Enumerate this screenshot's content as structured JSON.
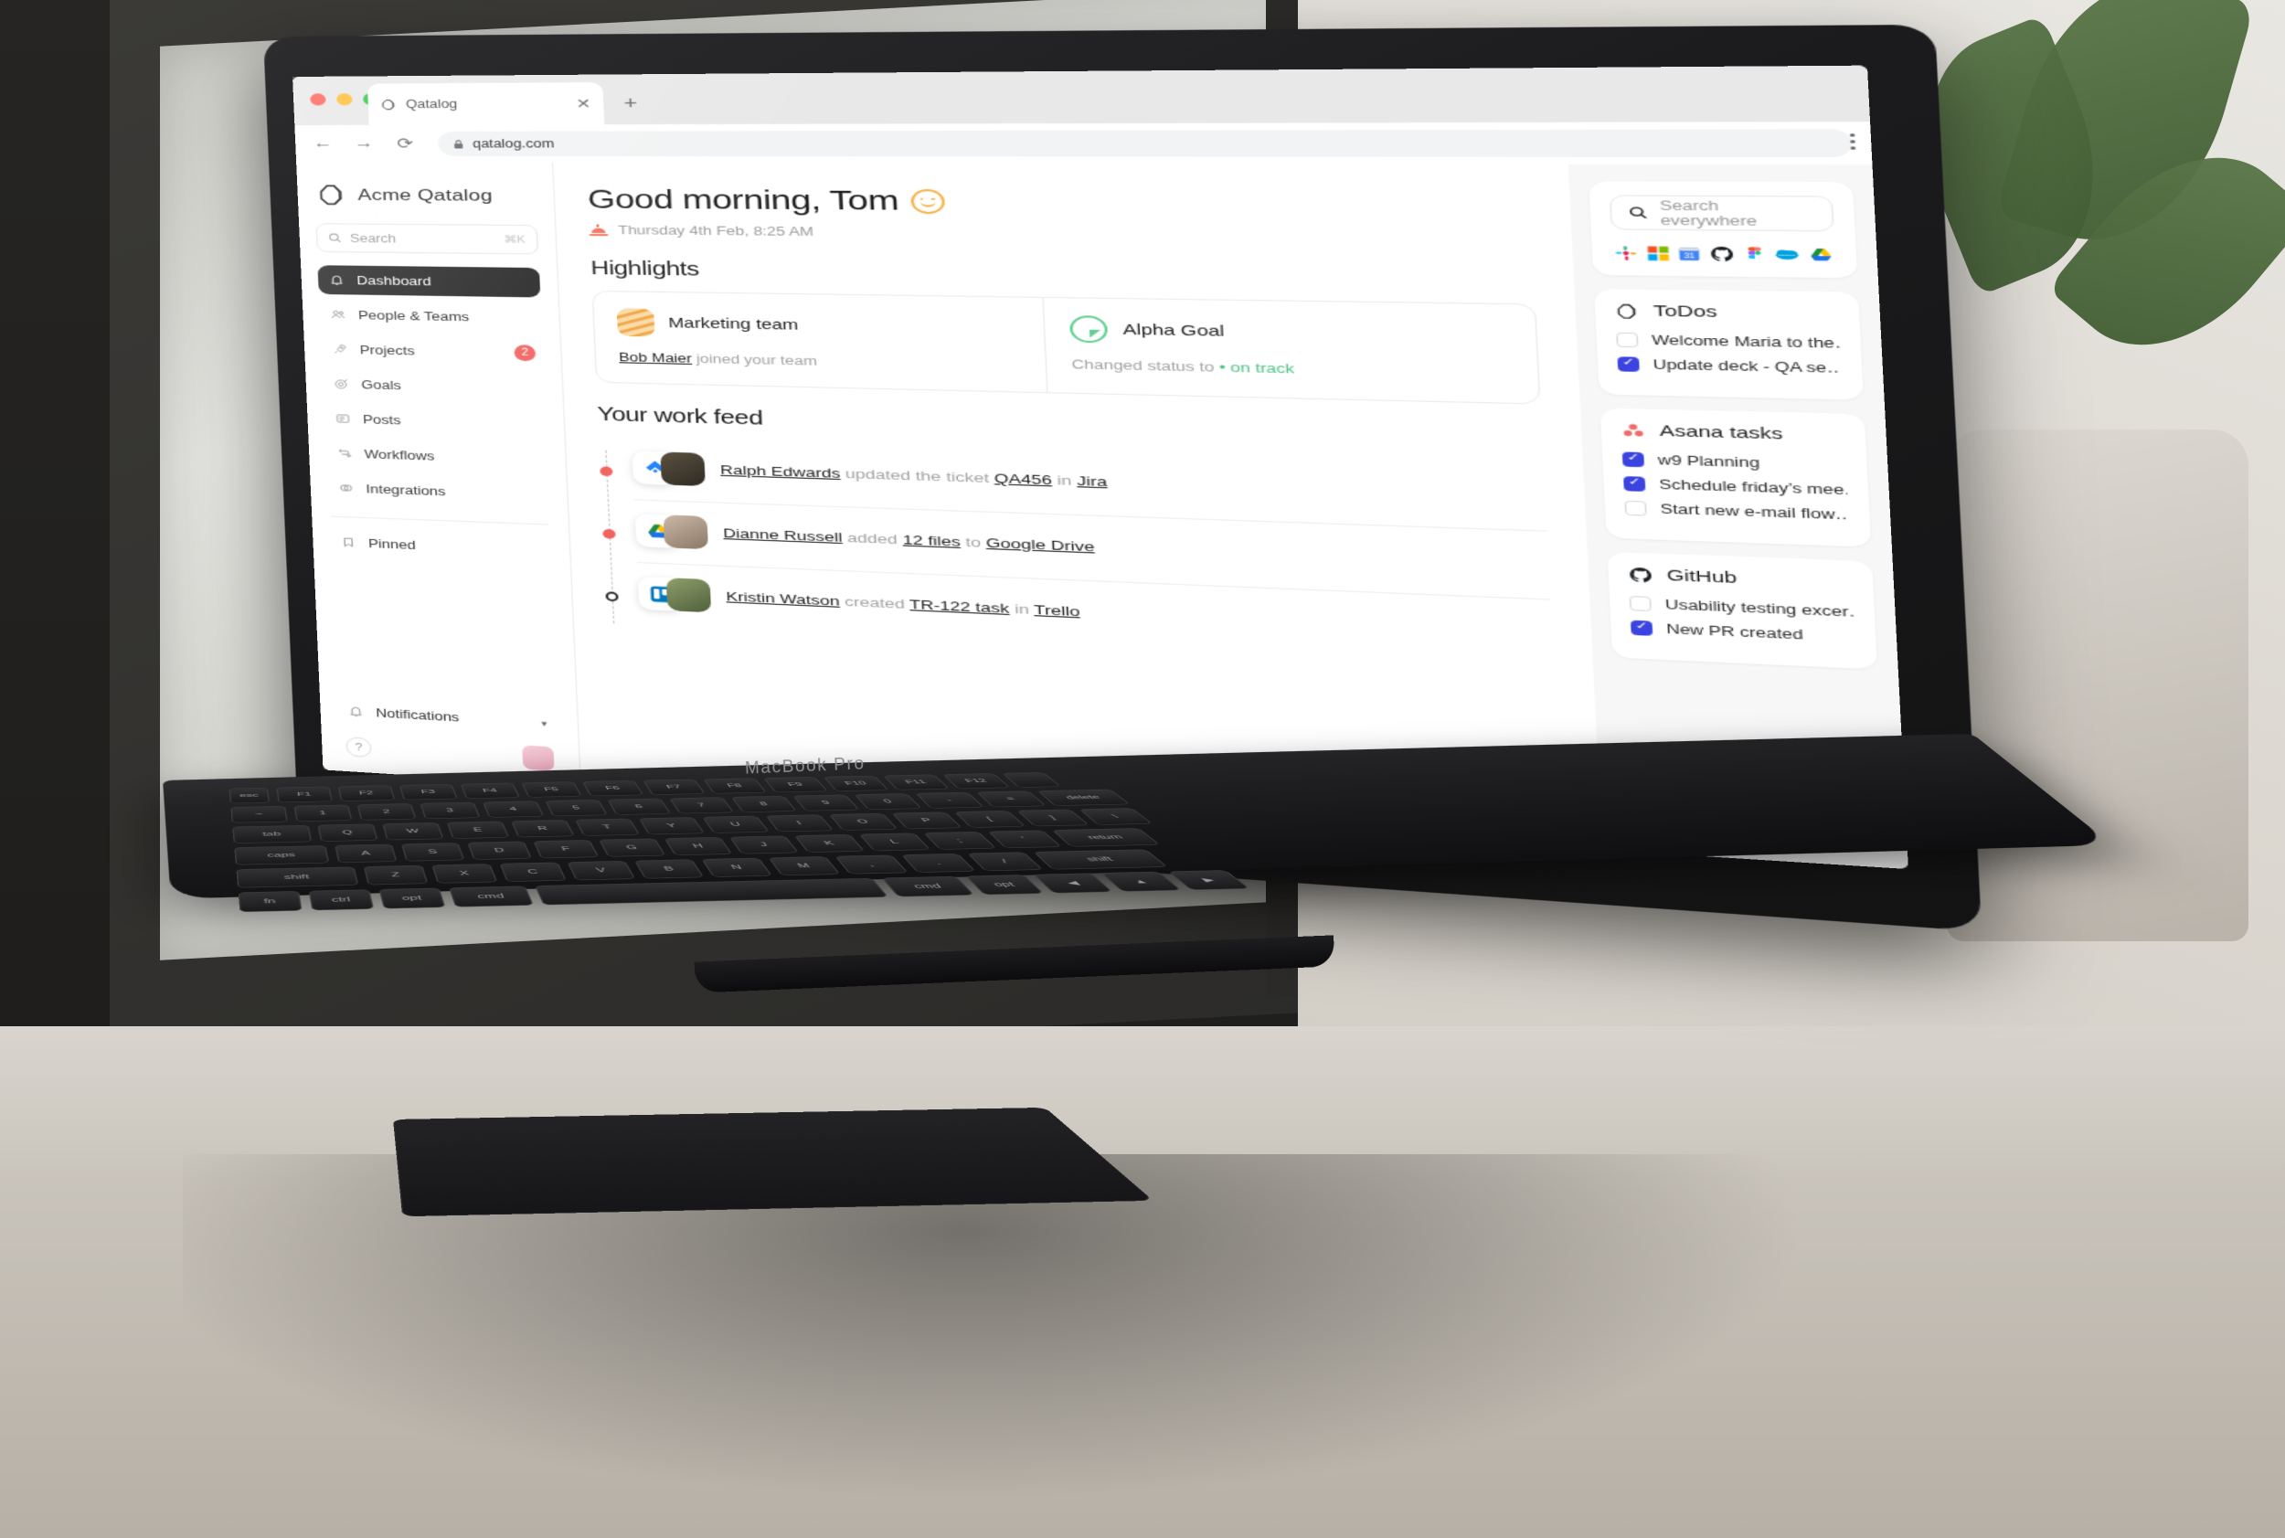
{
  "browser": {
    "tab_title": "Qatalog",
    "tab_close": "✕",
    "new_tab": "+",
    "back": "←",
    "forward": "→",
    "reload": "⟳",
    "url": "qatalog.com",
    "lock_icon": "lock-icon",
    "menu_icon": "kebab-menu-icon"
  },
  "laptop": {
    "model_label": "MacBook Pro"
  },
  "sidebar": {
    "brand": "Acme Qatalog",
    "search": {
      "placeholder": "Search",
      "shortcut": "⌘K"
    },
    "items": [
      {
        "label": "Dashboard",
        "icon": "bell-icon",
        "active": true,
        "badge": ""
      },
      {
        "label": "People & Teams",
        "icon": "people-icon",
        "active": false,
        "badge": ""
      },
      {
        "label": "Projects",
        "icon": "rocket-icon",
        "active": false,
        "badge": "2"
      },
      {
        "label": "Goals",
        "icon": "target-icon",
        "active": false,
        "badge": ""
      },
      {
        "label": "Posts",
        "icon": "posts-icon",
        "active": false,
        "badge": ""
      },
      {
        "label": "Workflows",
        "icon": "workflow-icon",
        "active": false,
        "badge": ""
      },
      {
        "label": "Integrations",
        "icon": "integrations-icon",
        "active": false,
        "badge": ""
      }
    ],
    "pinned": {
      "label": "Pinned",
      "icon": "bookmark-icon"
    },
    "notifications": {
      "label": "Notifications",
      "icon": "bell-icon",
      "chevron": "▾"
    },
    "help_icon": "help-circle-icon",
    "avatar": "user-avatar"
  },
  "main": {
    "greeting": "Good morning, Tom",
    "smiley_icon": "smiley-face-icon",
    "date": "Thursday 4th Feb, 8:25 AM",
    "sunrise_icon": "sunrise-icon",
    "highlights_title": "Highlights",
    "highlights": [
      {
        "name": "Marketing team",
        "icon": "marketing-team-icon",
        "actor": "Bob Maier",
        "text": "joined your team"
      },
      {
        "name": "Alpha Goal",
        "icon": "goal-progress-icon",
        "prefix": "Changed status to",
        "status": "• on track"
      }
    ],
    "feed_title": "Your work feed",
    "feed": [
      {
        "app_icon": "jira-icon",
        "actor": "Ralph Edwards",
        "verb": "updated the ticket",
        "object": "QA456",
        "prep": "in",
        "place": "Jira",
        "dot": "solid"
      },
      {
        "app_icon": "google-drive-icon",
        "actor": "Dianne Russell",
        "verb": "added",
        "object": "12 files",
        "prep": "to",
        "place": "Google Drive",
        "dot": "solid"
      },
      {
        "app_icon": "trello-icon",
        "actor": "Kristin Watson",
        "verb": "created",
        "object": "TR-122 task",
        "prep": "in",
        "place": "Trello",
        "dot": "hollow"
      }
    ]
  },
  "rail": {
    "search": {
      "placeholder": "Search everywhere",
      "icon": "search-icon"
    },
    "apps": [
      "slack-icon",
      "microsoft-icon",
      "google-calendar-icon",
      "github-icon",
      "figma-icon",
      "salesforce-icon",
      "google-drive-icon"
    ],
    "widgets": [
      {
        "title": "ToDos",
        "icon": "qatalog-icon",
        "items": [
          {
            "label": "Welcome Maria to the…",
            "checked": false
          },
          {
            "label": "Update deck - QA se…",
            "checked": true
          }
        ]
      },
      {
        "title": "Asana tasks",
        "icon": "asana-icon",
        "items": [
          {
            "label": "w9 Planning",
            "checked": true
          },
          {
            "label": "Schedule friday’s mee…",
            "checked": true
          },
          {
            "label": "Start new e-mail flow…",
            "checked": false
          }
        ]
      },
      {
        "title": "GitHub",
        "icon": "github-icon",
        "items": [
          {
            "label": "Usability testing excer…",
            "checked": false
          },
          {
            "label": "New PR created",
            "checked": true
          }
        ]
      }
    ]
  },
  "colors": {
    "accent_checkbox": "#3b43e0",
    "badge_red": "#f2635f",
    "on_track_green": "#4cc283",
    "active_nav": "#262626"
  }
}
